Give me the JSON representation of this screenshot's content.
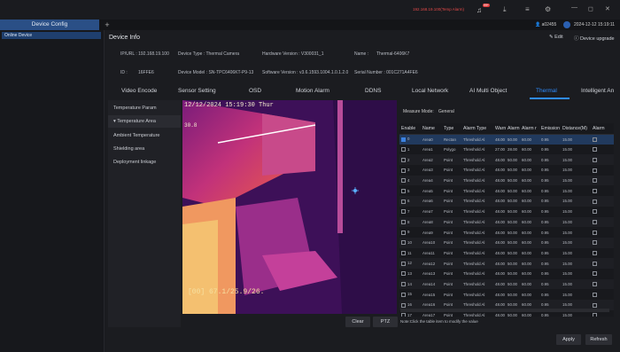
{
  "window": {
    "tab_label": "Device Config",
    "add_tab": "+",
    "alarm_text": "192.168.19.100(Temp Alarm)",
    "alarm_count": "99+",
    "user": "a02455",
    "datetime": "2024-12-12 15:19:11",
    "win_minimize": "—",
    "win_maximize": "◻",
    "win_close": "✕"
  },
  "tree": {
    "root": "Online Device"
  },
  "device_info": {
    "title": "Device Info",
    "edit": "Edit",
    "upgrade": "Device upgrade",
    "ip": "IP/URL : 192.168.19.100",
    "type": "Device Type : Thermal Camera",
    "hw": "Hardware Version : V300031_1",
    "name_label": "Name :",
    "name_value": "Thermal-6406K7",
    "id": "ID :",
    "id_value": "16FFE6",
    "model": "Device Model : SN-TPC6406KT-P9-13",
    "sw": "Software Version : v3.6.1593.1004.1.0.1.2.0",
    "serial": "Serial Number : 001C271A4FE6"
  },
  "nav": [
    "Video Encode",
    "Sensor Setting",
    "OSD",
    "Motion Alarm",
    "DDNS",
    "Local Network",
    "AI Multi Object",
    "Thermal",
    "Intelligent An"
  ],
  "side": [
    "Temperature Param",
    "Temperature Area",
    "Ambient Temperature",
    "Shielding area",
    "Deployment linkage"
  ],
  "video": {
    "osd_top": "12/12/2024 15:19:30 Thur",
    "osd_left": "30.8",
    "osd_bottom": "[00] 67.1/25.9/26."
  },
  "measure": {
    "label": "Measure Mode:",
    "value": "General"
  },
  "table": {
    "headers": [
      "Enable",
      "Name",
      "Type",
      "Alarm Type",
      "Warn",
      "Alarm",
      "Alarm r",
      "Emission",
      "Distance(M)",
      "Alarm"
    ],
    "rows": [
      [
        "0",
        "Area0",
        "Rectan",
        "Threshold Al",
        "48.00",
        "50.00",
        "60.00",
        "0.95",
        "15.00"
      ],
      [
        "1",
        "Area1",
        "Polygo",
        "Threshold Al",
        "27.00",
        "28.00",
        "60.00",
        "0.95",
        "15.00"
      ],
      [
        "2",
        "Area2",
        "Point",
        "Threshold Al",
        "48.00",
        "50.00",
        "60.00",
        "0.95",
        "15.00"
      ],
      [
        "3",
        "Area3",
        "Point",
        "Threshold Al",
        "48.00",
        "50.00",
        "60.00",
        "0.95",
        "15.00"
      ],
      [
        "4",
        "Area4",
        "Point",
        "Threshold Al",
        "48.00",
        "50.00",
        "60.00",
        "0.95",
        "15.00"
      ],
      [
        "5",
        "Area5",
        "Point",
        "Threshold Al",
        "48.00",
        "50.00",
        "60.00",
        "0.95",
        "15.00"
      ],
      [
        "6",
        "Area6",
        "Point",
        "Threshold Al",
        "48.00",
        "50.00",
        "60.00",
        "0.95",
        "15.00"
      ],
      [
        "7",
        "Area7",
        "Point",
        "Threshold Al",
        "48.00",
        "50.00",
        "60.00",
        "0.95",
        "15.00"
      ],
      [
        "8",
        "Area8",
        "Point",
        "Threshold Al",
        "48.00",
        "50.00",
        "60.00",
        "0.95",
        "15.00"
      ],
      [
        "9",
        "Area9",
        "Point",
        "Threshold Al",
        "48.00",
        "50.00",
        "60.00",
        "0.95",
        "15.00"
      ],
      [
        "10",
        "Area10",
        "Point",
        "Threshold Al",
        "48.00",
        "50.00",
        "60.00",
        "0.95",
        "15.00"
      ],
      [
        "11",
        "Area11",
        "Point",
        "Threshold Al",
        "48.00",
        "50.00",
        "60.00",
        "0.95",
        "15.00"
      ],
      [
        "12",
        "Area12",
        "Point",
        "Threshold Al",
        "48.00",
        "50.00",
        "60.00",
        "0.95",
        "15.00"
      ],
      [
        "13",
        "Area13",
        "Point",
        "Threshold Al",
        "48.00",
        "50.00",
        "60.00",
        "0.95",
        "15.00"
      ],
      [
        "14",
        "Area14",
        "Point",
        "Threshold Al",
        "48.00",
        "50.00",
        "60.00",
        "0.95",
        "15.00"
      ],
      [
        "15",
        "Area15",
        "Point",
        "Threshold Al",
        "48.00",
        "50.00",
        "60.00",
        "0.95",
        "15.00"
      ],
      [
        "16",
        "Area16",
        "Point",
        "Threshold Al",
        "48.00",
        "50.00",
        "60.00",
        "0.95",
        "15.00"
      ],
      [
        "17",
        "Area17",
        "Point",
        "Threshold Al",
        "48.00",
        "50.00",
        "60.00",
        "0.95",
        "15.00"
      ]
    ],
    "checked": [
      true,
      false,
      false,
      false,
      false,
      false,
      false,
      false,
      false,
      false,
      false,
      false,
      false,
      false,
      false,
      false,
      false,
      false
    ]
  },
  "buttons": {
    "clear": "Clear",
    "ptz": "PTZ",
    "apply": "Apply",
    "refresh": "Refresh"
  },
  "note": "Note:Click the table item to modify the value",
  "colors": {
    "accent": "#2f8cff",
    "alarm": "#e03a3a",
    "video_bg": "#3a0f5a"
  }
}
